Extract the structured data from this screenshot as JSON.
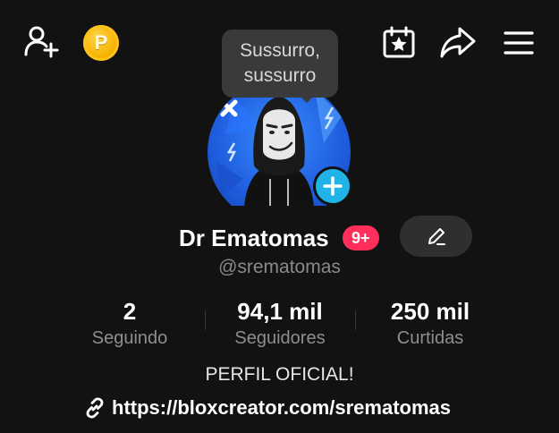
{
  "top_bar": {
    "coin_letter": "P",
    "icons": [
      "add-user-icon",
      "coin-icon",
      "calendar-star-icon",
      "share-icon",
      "menu-icon"
    ]
  },
  "tooltip": {
    "line1": "Sussurro,",
    "line2": "sussurro"
  },
  "profile": {
    "display_name": "Dr Ematomas",
    "notification_badge": "9+",
    "handle": "@srematomas"
  },
  "stats": [
    {
      "value": "2",
      "label": "Seguindo"
    },
    {
      "value": "94,1 mil",
      "label": "Seguidores"
    },
    {
      "value": "250 mil",
      "label": "Curtidas"
    }
  ],
  "bio": {
    "text": "PERFIL OFICIAL!",
    "link": "https://bloxcreator.com/srematomas"
  },
  "colors": {
    "background": "#121212",
    "badge": "#ff2e5a",
    "add_button": "#20b3e8",
    "coin": "#f5b400"
  }
}
